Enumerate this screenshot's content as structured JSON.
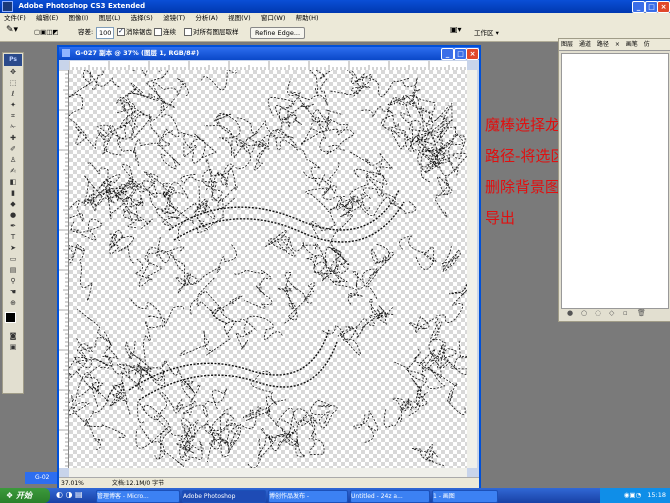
{
  "app": {
    "title": "Adobe Photoshop CS3 Extended",
    "menu": [
      "文件(F)",
      "编辑(E)",
      "图像(I)",
      "图层(L)",
      "选择(S)",
      "滤镜(T)",
      "分析(A)",
      "视图(V)",
      "窗口(W)",
      "帮助(H)"
    ],
    "workspace_label": "工作区 ▾"
  },
  "options": {
    "tolerance_label": "容差:",
    "tolerance_value": "100",
    "antialias_label": "消除锯齿",
    "contiguous_label": "连续",
    "all_layers_label": "对所有图层取样",
    "refine_label": "Refine Edge..."
  },
  "tools": {
    "logo": "Ps"
  },
  "document": {
    "title": "G-027 副本 @ 37% (图层 1, RGB/8#)",
    "zoom": "37.01%",
    "doc_size": "文档:12.1M/0 字节"
  },
  "annotation": {
    "line1": "魔棒选择龙，",
    "line2": "路径-将选区生成路径",
    "line3": "删除背景图层",
    "line4": "导出"
  },
  "panel": {
    "tabs": [
      "图层",
      "通道",
      "路径",
      "×",
      "画笔",
      "仿"
    ]
  },
  "minimized_doc": "G-02",
  "taskbar": {
    "start": "开始",
    "tasks": [
      "管理博客 - Micro...",
      "Adobe Photoshop",
      "博创作品发布 -",
      "Untitled - 24z a...",
      "1 - 画图"
    ],
    "time": "15:18"
  },
  "colors": {
    "accent": "#0050d8",
    "annotation": "#e01010",
    "taskbar": "#2456c4"
  }
}
